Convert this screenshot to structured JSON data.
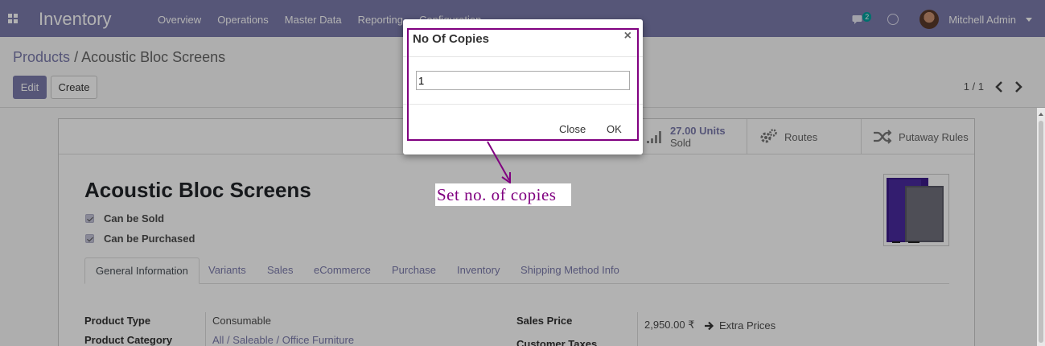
{
  "navbar": {
    "app_title": "Inventory",
    "menu": [
      "Overview",
      "Operations",
      "Master Data",
      "Reporting",
      "Configuration"
    ],
    "chat_count": "2",
    "user_name": "Mitchell Admin"
  },
  "control_panel": {
    "breadcrumb_parent": "Products",
    "breadcrumb_separator": "/",
    "breadcrumb_current": "Acoustic Bloc Screens",
    "edit_label": "Edit",
    "create_label": "Create",
    "pager": "1 / 1"
  },
  "form": {
    "stat_buttons": {
      "sold_value": "27.00 Units",
      "sold_label": "Sold",
      "routes": "Routes",
      "putaway": "Putaway Rules"
    },
    "product_name": "Acoustic Bloc Screens",
    "can_be_sold": "Can be Sold",
    "can_be_purchased": "Can be Purchased",
    "tabs": [
      "General Information",
      "Variants",
      "Sales",
      "eCommerce",
      "Purchase",
      "Inventory",
      "Shipping Method Info"
    ],
    "fields": {
      "product_type_label": "Product Type",
      "product_type_value": "Consumable",
      "product_category_label": "Product Category",
      "product_category_value": "All / Saleable / Office Furniture",
      "sales_price_label": "Sales Price",
      "sales_price_value": "2,950.00 ₹",
      "extra_prices": "Extra Prices",
      "customer_taxes_label": "Customer Taxes"
    }
  },
  "dialog": {
    "title": "No Of Copies",
    "close_symbol": "×",
    "input_value": "1",
    "close_label": "Close",
    "ok_label": "OK"
  },
  "annotation": {
    "text": "Set no. of copies",
    "color": "#800080"
  },
  "colors": {
    "brand": "#7c7bad",
    "annotation": "#800080"
  }
}
